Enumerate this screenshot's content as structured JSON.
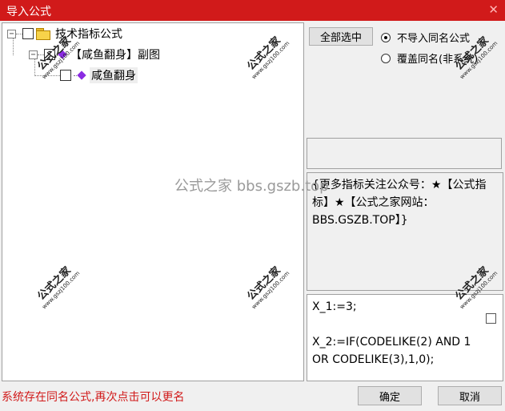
{
  "window": {
    "title": "导入公式",
    "close_glyph": "✕"
  },
  "tree": {
    "root_label": "技术指标公式",
    "group_label": "【咸鱼翻身】副图",
    "leaf_label": "咸鱼翻身",
    "expander_glyph": "−"
  },
  "options": {
    "select_all_label": "全部选中",
    "radio_no_import_label": "不导入同名公式",
    "radio_overwrite_label": "覆盖同名(非系统)",
    "selected_radio": "不导入同名公式"
  },
  "description": {
    "text": "{更多指标关注公众号：★【公式指标】★【公式之家网站：BBS.GSZB.TOP】}"
  },
  "code": {
    "text": "X_1:=3;\n\nX_2:=IF(CODELIKE(2) AND 1 OR CODELIKE(3),1,0);"
  },
  "status": {
    "message": "系统存在同名公式,再次点击可以更名"
  },
  "buttons": {
    "ok_label": "确定",
    "cancel_label": "取消"
  },
  "watermark": {
    "center_text": "公式之家 bbs.gszb.top",
    "stamp_big": "公式之家",
    "stamp_small": "www.gszj100.com"
  },
  "colors": {
    "titlebar": "#d11a1a",
    "status_text": "#d11a1a"
  }
}
